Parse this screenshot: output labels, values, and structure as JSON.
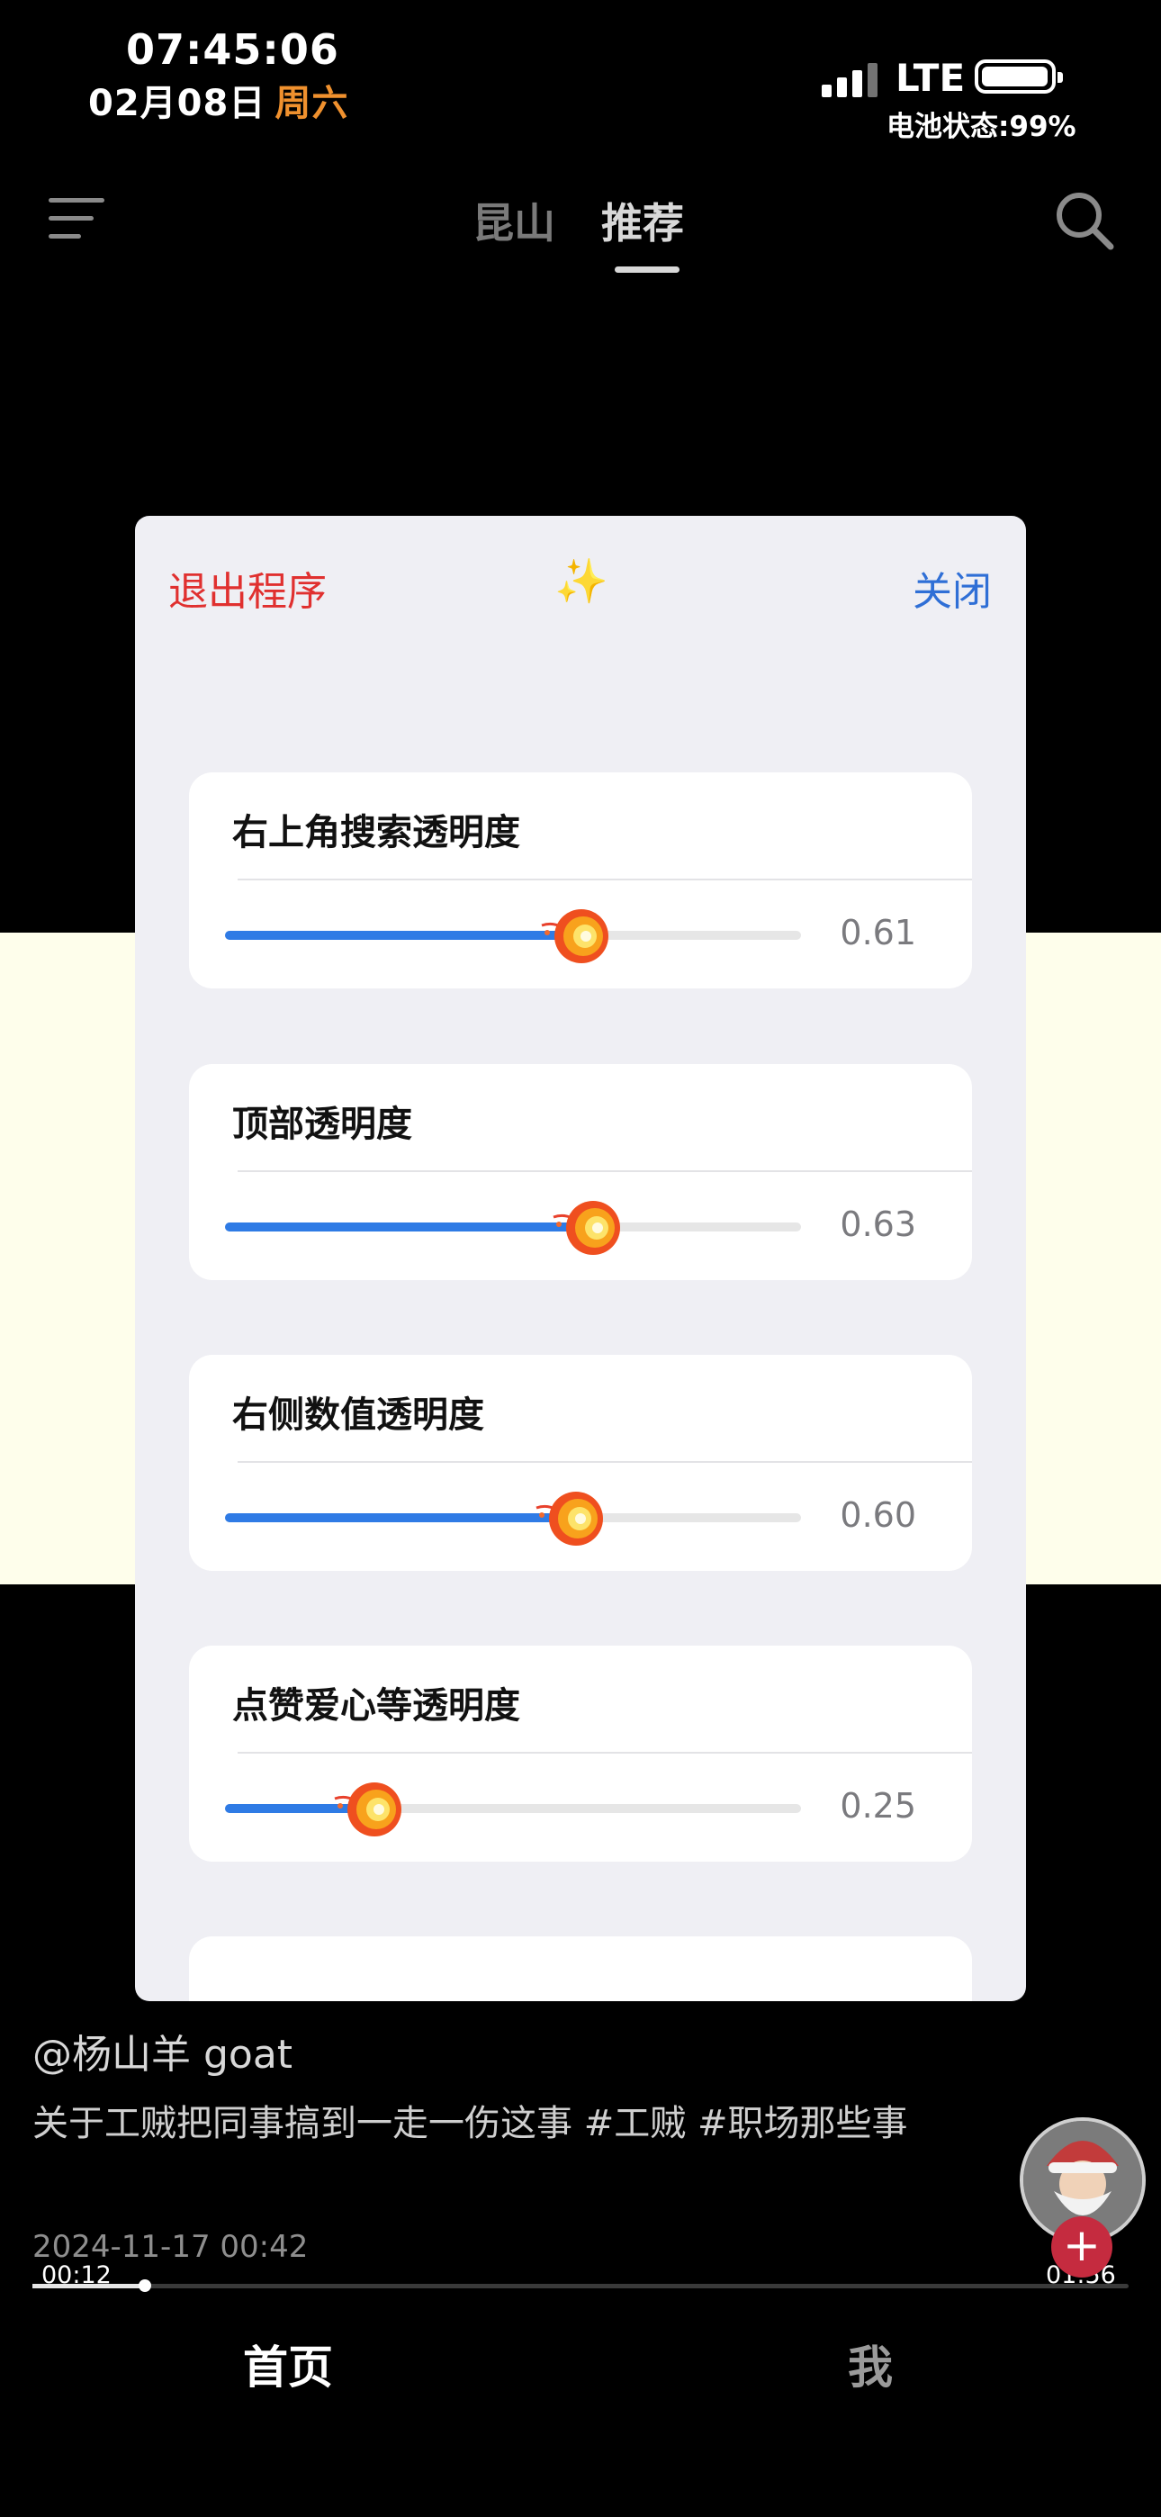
{
  "status_bar": {
    "time": "07:45:06",
    "date": "02月08日",
    "weekday": "周六",
    "network": "LTE",
    "battery_text": "电池状态:99%",
    "battery_level": 0.99
  },
  "top_nav": {
    "menu_icon": "menu-icon",
    "tabs": [
      {
        "label": "昆山",
        "active": false
      },
      {
        "label": "推荐",
        "active": true
      }
    ],
    "search_icon": "search-icon"
  },
  "panel": {
    "exit_label": "退出程序",
    "sparkle": "✨",
    "close_label": "关闭",
    "sliders": [
      {
        "label": "右上角搜索透明度",
        "value": 0.61,
        "value_text": "0.61"
      },
      {
        "label": "顶部透明度",
        "value": 0.63,
        "value_text": "0.63"
      },
      {
        "label": "右侧数值透明度",
        "value": 0.6,
        "value_text": "0.60"
      },
      {
        "label": "点赞爱心等透明度",
        "value": 0.25,
        "value_text": "0.25"
      }
    ],
    "thumb_icon": "fireball-icon"
  },
  "video": {
    "author": "@杨山羊 goat",
    "caption": "关于工贼把同事搞到一走一伤这事 #工贼 #职场那些事",
    "published": "2024-11-17 00:42",
    "time_current": "00:12",
    "time_total": "01:56",
    "progress": 0.103,
    "follow_symbol": "+"
  },
  "bottom_nav": {
    "home_label": "首页",
    "me_label": "我"
  },
  "colors": {
    "accent_blue": "#2f7be5",
    "exit_red": "#e0302f",
    "close_blue": "#2f6fd6",
    "weekday_orange": "#f0912e"
  }
}
